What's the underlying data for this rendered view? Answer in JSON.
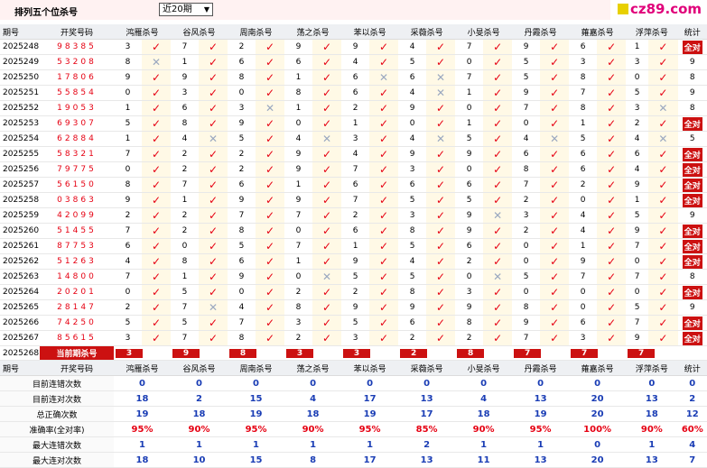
{
  "toolbar": {
    "title": "排列五个位杀号",
    "period_selected": "近20期",
    "dropdown_arrow": "▼",
    "logo_text": "cz89.com"
  },
  "columns": [
    "期号",
    "开奖号码",
    "鸿雁杀号",
    "谷风杀号",
    "周南杀号",
    "荡之杀号",
    "苯以杀号",
    "采薇杀号",
    "小旻杀号",
    "丹霞杀号",
    "蕹嘉杀号",
    "浮萍杀号",
    "统计"
  ],
  "rows": [
    {
      "period": "2025248",
      "number": "98385",
      "kills": [
        [
          3,
          1
        ],
        [
          7,
          1
        ],
        [
          2,
          1
        ],
        [
          9,
          1
        ],
        [
          9,
          1
        ],
        [
          4,
          1
        ],
        [
          7,
          1
        ],
        [
          9,
          1
        ],
        [
          6,
          1
        ],
        [
          1,
          1
        ]
      ],
      "stat": "全对"
    },
    {
      "period": "2025249",
      "number": "53208",
      "kills": [
        [
          8,
          0
        ],
        [
          1,
          1
        ],
        [
          6,
          1
        ],
        [
          6,
          1
        ],
        [
          4,
          1
        ],
        [
          5,
          1
        ],
        [
          0,
          1
        ],
        [
          5,
          1
        ],
        [
          3,
          1
        ],
        [
          3,
          1
        ]
      ],
      "stat": "9"
    },
    {
      "period": "2025250",
      "number": "17806",
      "kills": [
        [
          9,
          1
        ],
        [
          9,
          1
        ],
        [
          8,
          1
        ],
        [
          1,
          1
        ],
        [
          6,
          0
        ],
        [
          6,
          0
        ],
        [
          7,
          1
        ],
        [
          5,
          1
        ],
        [
          8,
          1
        ],
        [
          0,
          1
        ]
      ],
      "stat": "8"
    },
    {
      "period": "2025251",
      "number": "55854",
      "kills": [
        [
          0,
          1
        ],
        [
          3,
          1
        ],
        [
          0,
          1
        ],
        [
          8,
          1
        ],
        [
          6,
          1
        ],
        [
          4,
          0
        ],
        [
          1,
          1
        ],
        [
          9,
          1
        ],
        [
          7,
          1
        ],
        [
          5,
          1
        ]
      ],
      "stat": "9"
    },
    {
      "period": "2025252",
      "number": "19053",
      "kills": [
        [
          1,
          1
        ],
        [
          6,
          1
        ],
        [
          3,
          0
        ],
        [
          1,
          1
        ],
        [
          2,
          1
        ],
        [
          9,
          1
        ],
        [
          0,
          1
        ],
        [
          7,
          1
        ],
        [
          8,
          1
        ],
        [
          3,
          0
        ]
      ],
      "stat": "8"
    },
    {
      "period": "2025253",
      "number": "69307",
      "kills": [
        [
          5,
          1
        ],
        [
          8,
          1
        ],
        [
          9,
          1
        ],
        [
          0,
          1
        ],
        [
          1,
          1
        ],
        [
          0,
          1
        ],
        [
          1,
          1
        ],
        [
          0,
          1
        ],
        [
          1,
          1
        ],
        [
          2,
          1
        ]
      ],
      "stat": "全对"
    },
    {
      "period": "2025254",
      "number": "62884",
      "kills": [
        [
          1,
          1
        ],
        [
          4,
          0
        ],
        [
          5,
          1
        ],
        [
          4,
          0
        ],
        [
          3,
          1
        ],
        [
          4,
          0
        ],
        [
          5,
          1
        ],
        [
          4,
          0
        ],
        [
          5,
          1
        ],
        [
          4,
          0
        ]
      ],
      "stat": "5"
    },
    {
      "period": "2025255",
      "number": "58321",
      "kills": [
        [
          7,
          1
        ],
        [
          2,
          1
        ],
        [
          2,
          1
        ],
        [
          9,
          1
        ],
        [
          4,
          1
        ],
        [
          9,
          1
        ],
        [
          9,
          1
        ],
        [
          6,
          1
        ],
        [
          6,
          1
        ],
        [
          6,
          1
        ]
      ],
      "stat": "全对"
    },
    {
      "period": "2025256",
      "number": "79775",
      "kills": [
        [
          0,
          1
        ],
        [
          2,
          1
        ],
        [
          2,
          1
        ],
        [
          9,
          1
        ],
        [
          7,
          1
        ],
        [
          3,
          1
        ],
        [
          0,
          1
        ],
        [
          8,
          1
        ],
        [
          6,
          1
        ],
        [
          4,
          1
        ]
      ],
      "stat": "全对"
    },
    {
      "period": "2025257",
      "number": "56150",
      "kills": [
        [
          8,
          1
        ],
        [
          7,
          1
        ],
        [
          6,
          1
        ],
        [
          1,
          1
        ],
        [
          6,
          1
        ],
        [
          6,
          1
        ],
        [
          6,
          1
        ],
        [
          7,
          1
        ],
        [
          2,
          1
        ],
        [
          9,
          1
        ]
      ],
      "stat": "全对"
    },
    {
      "period": "2025258",
      "number": "03863",
      "kills": [
        [
          9,
          1
        ],
        [
          1,
          1
        ],
        [
          9,
          1
        ],
        [
          9,
          1
        ],
        [
          7,
          1
        ],
        [
          5,
          1
        ],
        [
          5,
          1
        ],
        [
          2,
          1
        ],
        [
          0,
          1
        ],
        [
          1,
          1
        ]
      ],
      "stat": "全对"
    },
    {
      "period": "2025259",
      "number": "42099",
      "kills": [
        [
          2,
          1
        ],
        [
          2,
          1
        ],
        [
          7,
          1
        ],
        [
          7,
          1
        ],
        [
          2,
          1
        ],
        [
          3,
          1
        ],
        [
          9,
          0
        ],
        [
          3,
          1
        ],
        [
          4,
          1
        ],
        [
          5,
          1
        ]
      ],
      "stat": "9"
    },
    {
      "period": "2025260",
      "number": "51455",
      "kills": [
        [
          7,
          1
        ],
        [
          2,
          1
        ],
        [
          8,
          1
        ],
        [
          0,
          1
        ],
        [
          6,
          1
        ],
        [
          8,
          1
        ],
        [
          9,
          1
        ],
        [
          2,
          1
        ],
        [
          4,
          1
        ],
        [
          9,
          1
        ]
      ],
      "stat": "全对"
    },
    {
      "period": "2025261",
      "number": "87753",
      "kills": [
        [
          6,
          1
        ],
        [
          0,
          1
        ],
        [
          5,
          1
        ],
        [
          7,
          1
        ],
        [
          1,
          1
        ],
        [
          5,
          1
        ],
        [
          6,
          1
        ],
        [
          0,
          1
        ],
        [
          1,
          1
        ],
        [
          7,
          1
        ]
      ],
      "stat": "全对"
    },
    {
      "period": "2025262",
      "number": "51263",
      "kills": [
        [
          4,
          1
        ],
        [
          8,
          1
        ],
        [
          6,
          1
        ],
        [
          1,
          1
        ],
        [
          9,
          1
        ],
        [
          4,
          1
        ],
        [
          2,
          1
        ],
        [
          0,
          1
        ],
        [
          9,
          1
        ],
        [
          0,
          1
        ]
      ],
      "stat": "全对"
    },
    {
      "period": "2025263",
      "number": "14800",
      "kills": [
        [
          7,
          1
        ],
        [
          1,
          1
        ],
        [
          9,
          1
        ],
        [
          0,
          0
        ],
        [
          5,
          1
        ],
        [
          5,
          1
        ],
        [
          0,
          0
        ],
        [
          5,
          1
        ],
        [
          7,
          1
        ],
        [
          7,
          1
        ]
      ],
      "stat": "8"
    },
    {
      "period": "2025264",
      "number": "20201",
      "kills": [
        [
          0,
          1
        ],
        [
          5,
          1
        ],
        [
          0,
          1
        ],
        [
          2,
          1
        ],
        [
          2,
          1
        ],
        [
          8,
          1
        ],
        [
          3,
          1
        ],
        [
          0,
          1
        ],
        [
          0,
          1
        ],
        [
          0,
          1
        ]
      ],
      "stat": "全对"
    },
    {
      "period": "2025265",
      "number": "28147",
      "kills": [
        [
          2,
          1
        ],
        [
          7,
          0
        ],
        [
          4,
          1
        ],
        [
          8,
          1
        ],
        [
          9,
          1
        ],
        [
          9,
          1
        ],
        [
          9,
          1
        ],
        [
          8,
          1
        ],
        [
          0,
          1
        ],
        [
          5,
          1
        ]
      ],
      "stat": "9"
    },
    {
      "period": "2025266",
      "number": "74250",
      "kills": [
        [
          5,
          1
        ],
        [
          5,
          1
        ],
        [
          7,
          1
        ],
        [
          3,
          1
        ],
        [
          5,
          1
        ],
        [
          6,
          1
        ],
        [
          8,
          1
        ],
        [
          9,
          1
        ],
        [
          6,
          1
        ],
        [
          7,
          1
        ]
      ],
      "stat": "全对"
    },
    {
      "period": "2025267",
      "number": "85615",
      "kills": [
        [
          3,
          1
        ],
        [
          7,
          1
        ],
        [
          8,
          1
        ],
        [
          2,
          1
        ],
        [
          3,
          1
        ],
        [
          2,
          1
        ],
        [
          2,
          1
        ],
        [
          7,
          1
        ],
        [
          3,
          1
        ],
        [
          9,
          1
        ]
      ],
      "stat": "全对"
    }
  ],
  "current": {
    "period": "2025268",
    "label": "当前期杀号",
    "kills": [
      "3",
      "9",
      "8",
      "3",
      "3",
      "2",
      "8",
      "7",
      "7",
      "7"
    ]
  },
  "summary": [
    {
      "label": "目前连错次数",
      "values": [
        "0",
        "0",
        "0",
        "0",
        "0",
        "0",
        "0",
        "0",
        "0",
        "0",
        "0"
      ]
    },
    {
      "label": "目前连对次数",
      "values": [
        "18",
        "2",
        "15",
        "4",
        "17",
        "13",
        "4",
        "13",
        "20",
        "13",
        "2"
      ]
    },
    {
      "label": "总正确次数",
      "values": [
        "19",
        "18",
        "19",
        "18",
        "19",
        "17",
        "18",
        "19",
        "20",
        "18",
        "12"
      ]
    },
    {
      "label": "准确率(全对率)",
      "values": [
        "95%",
        "90%",
        "95%",
        "90%",
        "95%",
        "85%",
        "90%",
        "95%",
        "100%",
        "90%",
        "60%"
      ]
    },
    {
      "label": "最大连错次数",
      "values": [
        "1",
        "1",
        "1",
        "1",
        "1",
        "2",
        "1",
        "1",
        "0",
        "1",
        "4"
      ]
    },
    {
      "label": "最大连对次数",
      "values": [
        "18",
        "10",
        "15",
        "8",
        "17",
        "13",
        "11",
        "13",
        "20",
        "13",
        "7"
      ]
    }
  ],
  "colors": {
    "accent_red": "#e60012",
    "header_bg": "#eef0f3",
    "summary_blue": "#1a3db5"
  }
}
